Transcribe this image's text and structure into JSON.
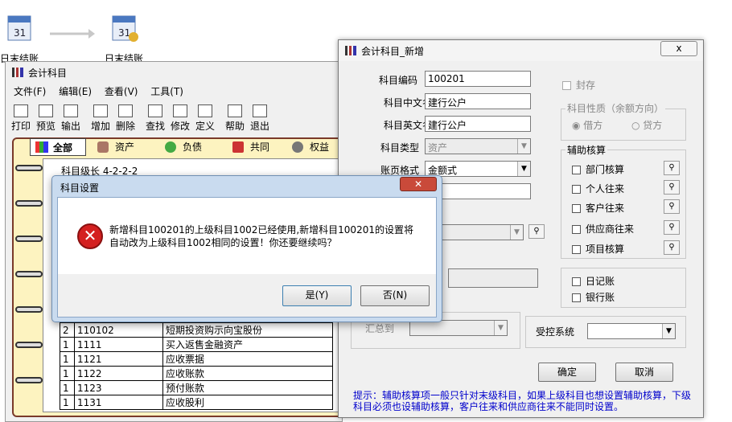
{
  "desktop": {
    "icon1_label": "日末结账",
    "icon2_label": "日末结账"
  },
  "main_window": {
    "title": "会计科目",
    "menu": [
      "文件(F)",
      "编辑(E)",
      "查看(V)",
      "工具(T)"
    ],
    "toolbar": [
      "打印",
      "预览",
      "输出",
      "增加",
      "删除",
      "查找",
      "修改",
      "定义",
      "帮助",
      "退出"
    ],
    "tabs": [
      "全部",
      "资产",
      "负债",
      "共同",
      "权益"
    ],
    "level_text": "科目级长 4-2-2-2",
    "rows": [
      {
        "level": "2",
        "code": "110102",
        "name": "短期投资购示向宝股份"
      },
      {
        "level": "1",
        "code": "1111",
        "name": "买入返售金融资产"
      },
      {
        "level": "1",
        "code": "1121",
        "name": "应收票据"
      },
      {
        "level": "1",
        "code": "1122",
        "name": "应收账款"
      },
      {
        "level": "1",
        "code": "1123",
        "name": "预付账款"
      },
      {
        "level": "1",
        "code": "1131",
        "name": "应收股利"
      }
    ]
  },
  "add_window": {
    "title": "会计科目_新增",
    "close_label": "x",
    "code_label": "科目编码",
    "code_value": "100201",
    "cn_name_label": "科目中文名称",
    "cn_name_value": "建行公户",
    "en_name_label": "科目英文名称",
    "en_name_value": "建行公户",
    "type_label": "科目类型",
    "type_value": "资产",
    "ledger_label": "账页格式",
    "ledger_value": "金额式",
    "sealed_label": "封存",
    "nature_label": "科目性质（余额方向）",
    "debit_label": "借方",
    "credit_label": "贷方",
    "aux_title": "辅助核算",
    "aux_items": [
      "部门核算",
      "个人往来",
      "客户往来",
      "供应商往来",
      "项目核算"
    ],
    "journal_label": "日记账",
    "bank_label": "银行账",
    "summary_label": "汇总到",
    "control_label": "受控系统",
    "ok_label": "确定",
    "cancel_label": "取消",
    "tip": "提示：辅助核算项一般只针对末级科目，如果上级科目也想设置辅助核算，下级科目必须也设辅助核算，客户往来和供应商往来不能同时设置。"
  },
  "dialog": {
    "title": "科目设置",
    "message": "新增科目100201的上级科目1002已经使用,新增科目100201的设置将自动改为上级科目1002相同的设置！你还要继续吗？",
    "yes_label": "是(Y)",
    "no_label": "否(N)"
  },
  "colors": {
    "dialog_border": "#c9dbef",
    "error_red": "#d42020",
    "tip_blue": "#0000cc"
  }
}
